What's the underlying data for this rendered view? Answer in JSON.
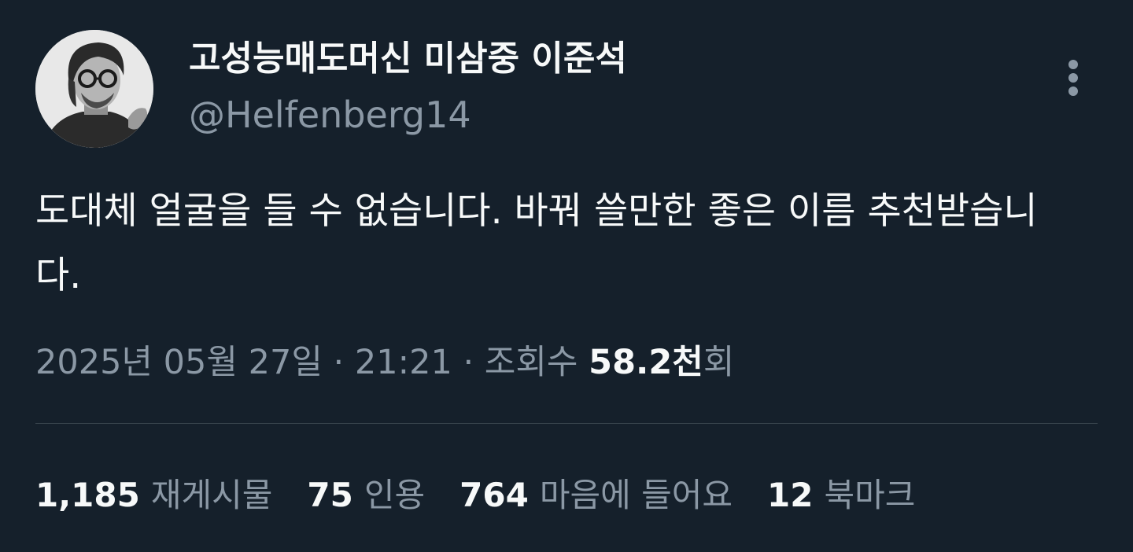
{
  "author": {
    "display_name": "고성능매도머신 미삼중 이준석",
    "handle": "@Helfenberg14"
  },
  "tweet": {
    "text": "도대체 얼굴을 들 수 없습니다. 바꿔 쓸만한 좋은 이름 추천받습니다."
  },
  "meta": {
    "timestamp": "2025년 05월 27일 · 21:21 · 조회수 ",
    "views_count": "58.2천",
    "views_suffix": "회"
  },
  "stats": [
    {
      "count": "1,185",
      "label": "재게시물"
    },
    {
      "count": "75",
      "label": "인용"
    },
    {
      "count": "764",
      "label": "마음에 들어요"
    },
    {
      "count": "12",
      "label": "북마크"
    }
  ],
  "icons": {
    "more": "more-vertical-icon",
    "avatar": "avatar"
  },
  "colors": {
    "background": "#15202b",
    "text_primary": "#f7f9f9",
    "text_secondary": "#8b98a5",
    "divider": "#38444d"
  }
}
